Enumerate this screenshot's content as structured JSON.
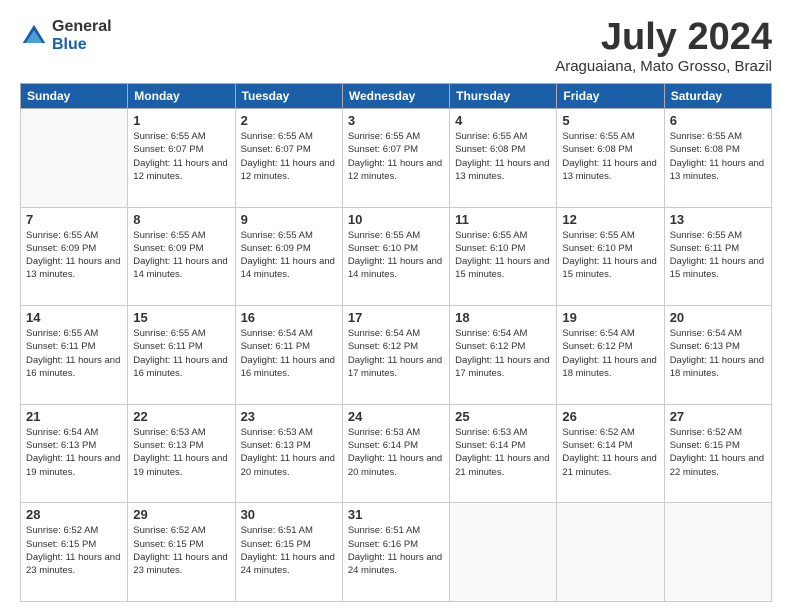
{
  "logo": {
    "general": "General",
    "blue": "Blue"
  },
  "header": {
    "month": "July 2024",
    "location": "Araguaiana, Mato Grosso, Brazil"
  },
  "weekdays": [
    "Sunday",
    "Monday",
    "Tuesday",
    "Wednesday",
    "Thursday",
    "Friday",
    "Saturday"
  ],
  "weeks": [
    [
      {
        "day": "",
        "sunrise": "",
        "sunset": "",
        "daylight": "",
        "empty": true
      },
      {
        "day": "1",
        "sunrise": "6:55 AM",
        "sunset": "6:07 PM",
        "daylight": "11 hours and 12 minutes."
      },
      {
        "day": "2",
        "sunrise": "6:55 AM",
        "sunset": "6:07 PM",
        "daylight": "11 hours and 12 minutes."
      },
      {
        "day": "3",
        "sunrise": "6:55 AM",
        "sunset": "6:07 PM",
        "daylight": "11 hours and 12 minutes."
      },
      {
        "day": "4",
        "sunrise": "6:55 AM",
        "sunset": "6:08 PM",
        "daylight": "11 hours and 13 minutes."
      },
      {
        "day": "5",
        "sunrise": "6:55 AM",
        "sunset": "6:08 PM",
        "daylight": "11 hours and 13 minutes."
      },
      {
        "day": "6",
        "sunrise": "6:55 AM",
        "sunset": "6:08 PM",
        "daylight": "11 hours and 13 minutes."
      }
    ],
    [
      {
        "day": "7",
        "sunrise": "6:55 AM",
        "sunset": "6:09 PM",
        "daylight": "11 hours and 13 minutes."
      },
      {
        "day": "8",
        "sunrise": "6:55 AM",
        "sunset": "6:09 PM",
        "daylight": "11 hours and 14 minutes."
      },
      {
        "day": "9",
        "sunrise": "6:55 AM",
        "sunset": "6:09 PM",
        "daylight": "11 hours and 14 minutes."
      },
      {
        "day": "10",
        "sunrise": "6:55 AM",
        "sunset": "6:10 PM",
        "daylight": "11 hours and 14 minutes."
      },
      {
        "day": "11",
        "sunrise": "6:55 AM",
        "sunset": "6:10 PM",
        "daylight": "11 hours and 15 minutes."
      },
      {
        "day": "12",
        "sunrise": "6:55 AM",
        "sunset": "6:10 PM",
        "daylight": "11 hours and 15 minutes."
      },
      {
        "day": "13",
        "sunrise": "6:55 AM",
        "sunset": "6:11 PM",
        "daylight": "11 hours and 15 minutes."
      }
    ],
    [
      {
        "day": "14",
        "sunrise": "6:55 AM",
        "sunset": "6:11 PM",
        "daylight": "11 hours and 16 minutes."
      },
      {
        "day": "15",
        "sunrise": "6:55 AM",
        "sunset": "6:11 PM",
        "daylight": "11 hours and 16 minutes."
      },
      {
        "day": "16",
        "sunrise": "6:54 AM",
        "sunset": "6:11 PM",
        "daylight": "11 hours and 16 minutes."
      },
      {
        "day": "17",
        "sunrise": "6:54 AM",
        "sunset": "6:12 PM",
        "daylight": "11 hours and 17 minutes."
      },
      {
        "day": "18",
        "sunrise": "6:54 AM",
        "sunset": "6:12 PM",
        "daylight": "11 hours and 17 minutes."
      },
      {
        "day": "19",
        "sunrise": "6:54 AM",
        "sunset": "6:12 PM",
        "daylight": "11 hours and 18 minutes."
      },
      {
        "day": "20",
        "sunrise": "6:54 AM",
        "sunset": "6:13 PM",
        "daylight": "11 hours and 18 minutes."
      }
    ],
    [
      {
        "day": "21",
        "sunrise": "6:54 AM",
        "sunset": "6:13 PM",
        "daylight": "11 hours and 19 minutes."
      },
      {
        "day": "22",
        "sunrise": "6:53 AM",
        "sunset": "6:13 PM",
        "daylight": "11 hours and 19 minutes."
      },
      {
        "day": "23",
        "sunrise": "6:53 AM",
        "sunset": "6:13 PM",
        "daylight": "11 hours and 20 minutes."
      },
      {
        "day": "24",
        "sunrise": "6:53 AM",
        "sunset": "6:14 PM",
        "daylight": "11 hours and 20 minutes."
      },
      {
        "day": "25",
        "sunrise": "6:53 AM",
        "sunset": "6:14 PM",
        "daylight": "11 hours and 21 minutes."
      },
      {
        "day": "26",
        "sunrise": "6:52 AM",
        "sunset": "6:14 PM",
        "daylight": "11 hours and 21 minutes."
      },
      {
        "day": "27",
        "sunrise": "6:52 AM",
        "sunset": "6:15 PM",
        "daylight": "11 hours and 22 minutes."
      }
    ],
    [
      {
        "day": "28",
        "sunrise": "6:52 AM",
        "sunset": "6:15 PM",
        "daylight": "11 hours and 23 minutes."
      },
      {
        "day": "29",
        "sunrise": "6:52 AM",
        "sunset": "6:15 PM",
        "daylight": "11 hours and 23 minutes."
      },
      {
        "day": "30",
        "sunrise": "6:51 AM",
        "sunset": "6:15 PM",
        "daylight": "11 hours and 24 minutes."
      },
      {
        "day": "31",
        "sunrise": "6:51 AM",
        "sunset": "6:16 PM",
        "daylight": "11 hours and 24 minutes."
      },
      {
        "day": "",
        "sunrise": "",
        "sunset": "",
        "daylight": "",
        "empty": true
      },
      {
        "day": "",
        "sunrise": "",
        "sunset": "",
        "daylight": "",
        "empty": true
      },
      {
        "day": "",
        "sunrise": "",
        "sunset": "",
        "daylight": "",
        "empty": true
      }
    ]
  ],
  "labels": {
    "sunrise_prefix": "Sunrise: ",
    "sunset_prefix": "Sunset: ",
    "daylight_prefix": "Daylight: "
  }
}
